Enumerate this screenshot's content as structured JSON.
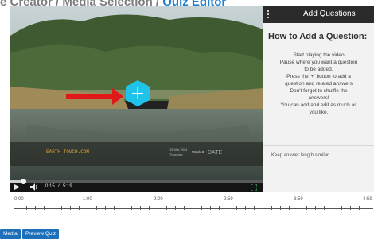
{
  "breadcrumb": {
    "prefix": "e Creator / Media Selection /",
    "current": "Quiz Editor"
  },
  "video": {
    "watermark_left": "EARTH-TOUCH.COM",
    "watermark_date": "15 Mar 2004",
    "watermark_day": "Thursday",
    "watermark_week": "Week 3",
    "watermark_right": "DATE",
    "current_time": "0:15",
    "duration": "5:19",
    "progress_fraction": 0.05
  },
  "panel": {
    "header_title": "Add Questions",
    "help_title": "How to Add a Question:",
    "help_lines": [
      "Start playing the video",
      "Pause where you want a question",
      "to be added.",
      "Press the '+' button to add a",
      "question and related answers",
      "Don't forget to shuffle the",
      "answers!",
      "You can add and edit as much as",
      "you like."
    ],
    "tip": "Keep answer length similar."
  },
  "timeline": {
    "labels": [
      "0:00",
      "1:00",
      "2:00",
      "2:59",
      "3:59",
      "4:59"
    ]
  },
  "buttons": {
    "media": "Media",
    "preview": "Preview Quiz"
  },
  "colors": {
    "accent": "#1e6fb9",
    "add_marker": "#1fc3ea",
    "arrow": "#e01818"
  }
}
